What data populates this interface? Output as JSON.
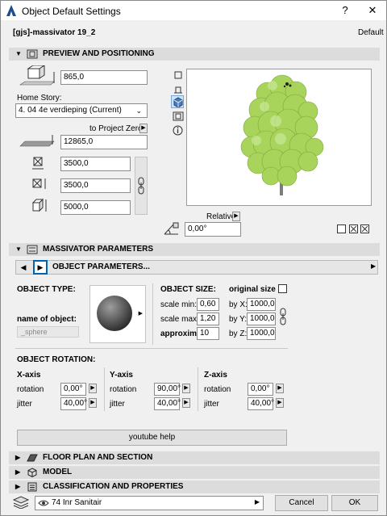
{
  "window": {
    "title": "Object Default Settings",
    "help": "?",
    "close": "✕"
  },
  "header": {
    "object_name": "[gjs]-massivator 19_2",
    "preset": "Default"
  },
  "preview_section": {
    "title": "PREVIEW AND POSITIONING",
    "elevation": "865,0",
    "home_story_label": "Home Story:",
    "home_story_value": "4. 04 4e verdieping (Current)",
    "to_project_zero_label": "to Project Zero",
    "project_zero_value": "12865,0",
    "x_size": "3500,0",
    "y_size": "3500,0",
    "z_size": "5000,0",
    "relative_label": "Relative",
    "rotation_value": "0,00°"
  },
  "massivator_section": {
    "title": "MASSIVATOR PARAMETERS"
  },
  "object_params": {
    "title": "OBJECT PARAMETERS...",
    "object_type_label": "OBJECT TYPE:",
    "name_of_object_label": "name of object:",
    "name_of_object_value": "_sphere",
    "object_size_label": "OBJECT SIZE:",
    "original_size_label": "original size",
    "scale_min_label": "scale min:",
    "scale_min_value": "0,60",
    "scale_max_label": "scale max:",
    "scale_max_value": "1,20",
    "approxim_label": "approxim.",
    "approxim_value": "10",
    "by_x_label": "by X:",
    "by_x_value": "1000,0",
    "by_y_label": "by Y:",
    "by_y_value": "1000,0",
    "by_z_label": "by Z:",
    "by_z_value": "1000,0",
    "object_rotation_label": "OBJECT ROTATION:",
    "x_axis_label": "X-axis",
    "y_axis_label": "Y-axis",
    "z_axis_label": "Z-axis",
    "rotation_label": "rotation",
    "jitter_label": "jitter",
    "x_rotation": "0,00°",
    "x_jitter": "40,00°",
    "y_rotation": "90,00°",
    "y_jitter": "40,00°",
    "z_rotation": "0,00°",
    "z_jitter": "40,00°",
    "youtube_help": "youtube help"
  },
  "collapsed_sections": {
    "floor_plan": "FLOOR PLAN AND SECTION",
    "model": "MODEL",
    "classification": "CLASSIFICATION AND PROPERTIES"
  },
  "footer": {
    "layer": "74 Inr Sanitair",
    "cancel": "Cancel",
    "ok": "OK"
  },
  "colors": {
    "section_bar": "#dcdcdc",
    "accent": "#0063b1",
    "tree_green": "#9fcf55"
  }
}
